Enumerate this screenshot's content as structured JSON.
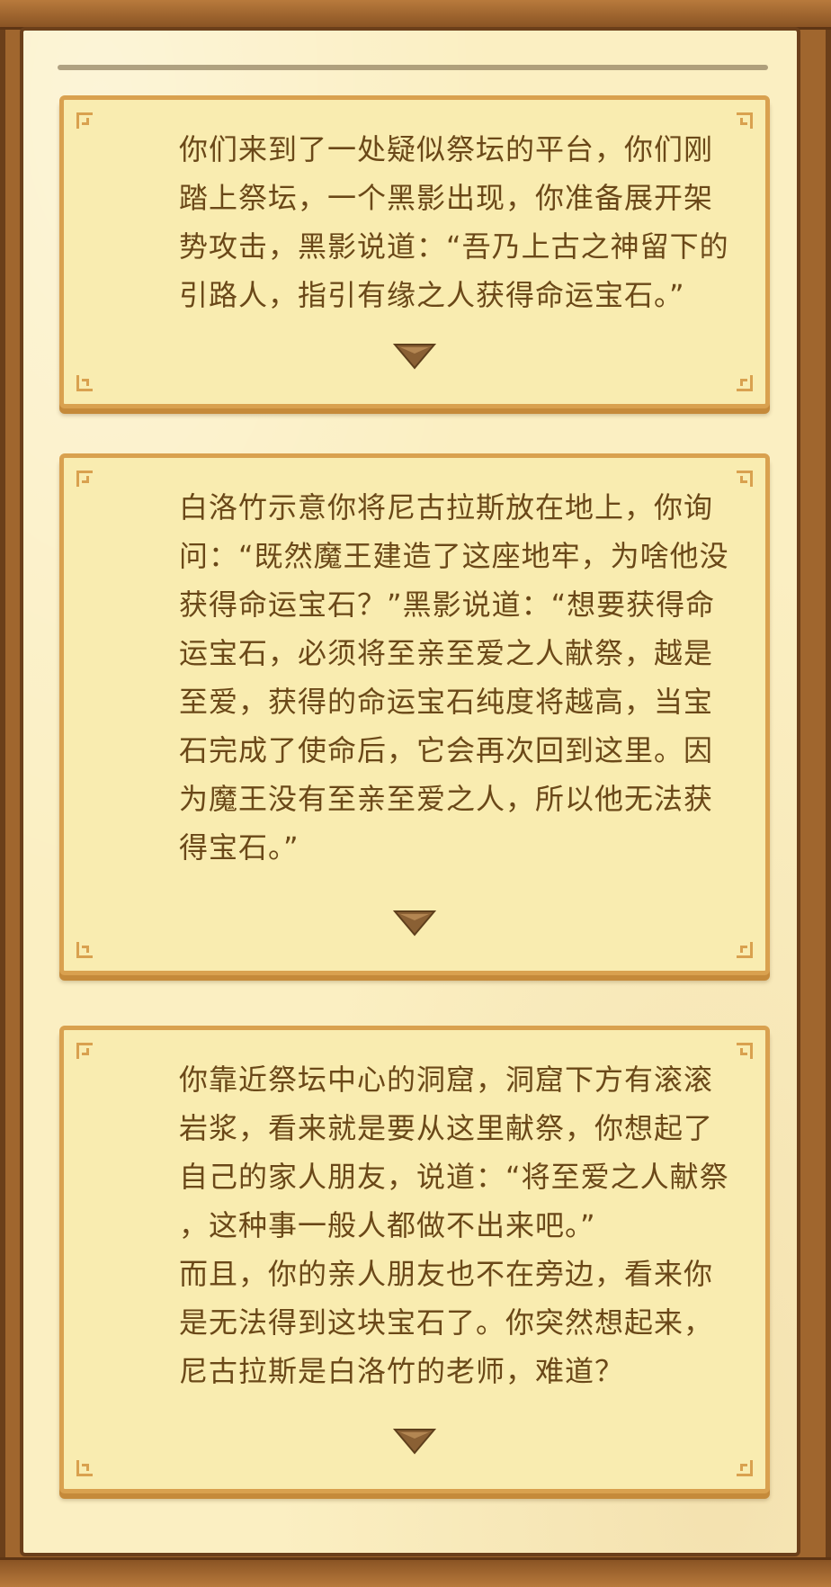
{
  "ui": {
    "parchment_color": "#fbefc2",
    "card_color": "#f9ecb0",
    "card_border_color": "#d9a14f",
    "text_color": "#6a4818",
    "frame_color": "#a0662e",
    "arrow_icon": "triangle-down-icon"
  },
  "dialogs": [
    {
      "text": "你们来到了一处疑似祭坛的平台，你们刚\n踏上祭坛，一个黑影出现，你准备展开架\n势攻击，黑影说道：“吾乃上古之神留下的\n引路人，指引有缘之人获得命运宝石。”"
    },
    {
      "text": "白洛竹示意你将尼古拉斯放在地上，你询\n问：“既然魔王建造了这座地牢，为啥他没\n获得命运宝石？”黑影说道：“想要获得命\n运宝石，必须将至亲至爱之人献祭，越是\n至爱，获得的命运宝石纯度将越高，当宝\n石完成了使命后，它会再次回到这里。因\n为魔王没有至亲至爱之人，所以他无法获\n得宝石。”"
    },
    {
      "text": "你靠近祭坛中心的洞窟，洞窟下方有滚滚\n岩浆，看来就是要从这里献祭，你想起了\n自己的家人朋友，说道：“将至爱之人献祭\n，这种事一般人都做不出来吧。”\n而且，你的亲人朋友也不在旁边，看来你\n是无法得到这块宝石了。你突然想起来，\n尼古拉斯是白洛竹的老师，难道？"
    }
  ]
}
